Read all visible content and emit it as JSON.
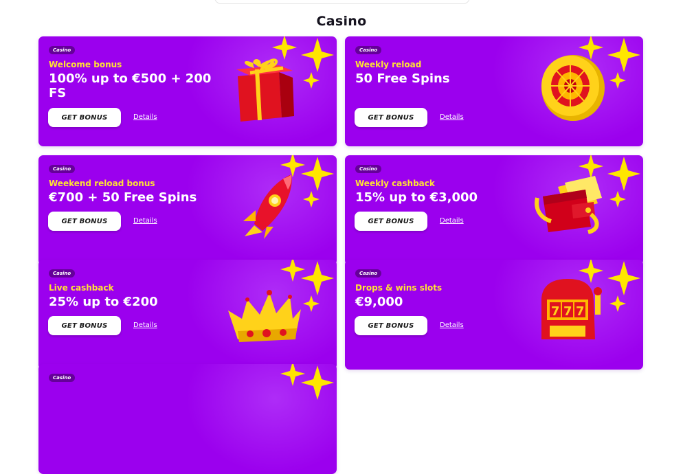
{
  "section": {
    "title": "Casino"
  },
  "button_label": "GET BONUS",
  "details_label": "Details",
  "cards": [
    {
      "tag": "Casino",
      "kicker": "Welcome bonus",
      "headline": "100% up to €500 + 200 FS",
      "icon": "gift-icon"
    },
    {
      "tag": "Casino",
      "kicker": "Weekly reload",
      "headline": "50 Free Spins",
      "icon": "roulette-icon"
    },
    {
      "tag": "Casino",
      "kicker": "Weekend reload bonus",
      "headline": "€700 + 50 Free Spins",
      "icon": "rocket-icon"
    },
    {
      "tag": "Casino",
      "kicker": "Weekly cashback",
      "headline": "15% up to €3,000",
      "icon": "wallet-icon"
    },
    {
      "tag": "Casino",
      "kicker": "Live cashback",
      "headline": "25% up to €200",
      "icon": "crown-icon"
    },
    {
      "tag": "Casino",
      "kicker": "Drops & wins slots",
      "headline": "€9,000",
      "icon": "slot-machine-icon"
    },
    {
      "tag": "Casino",
      "kicker": "",
      "headline": "",
      "icon": ""
    }
  ],
  "colors": {
    "card_bg": "#9b00ee",
    "kicker": "#ffe234",
    "star": "#ffe600"
  }
}
